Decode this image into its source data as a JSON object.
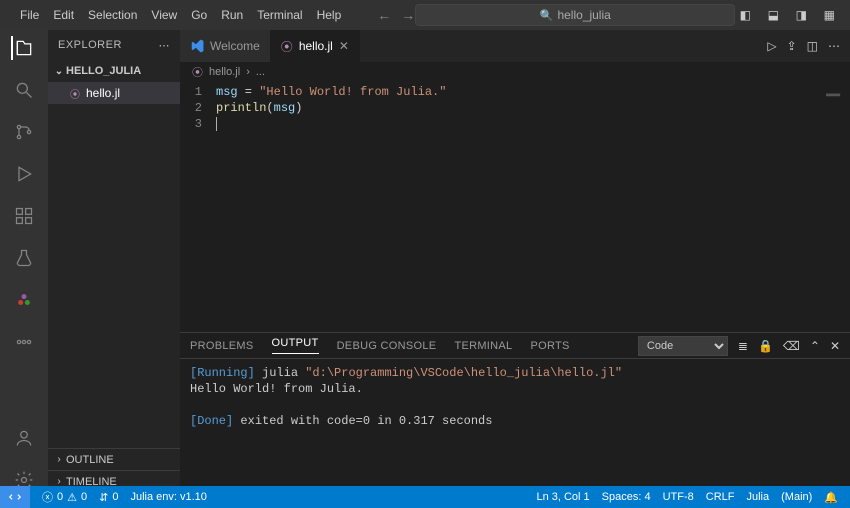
{
  "menu": {
    "items": [
      "File",
      "Edit",
      "Selection",
      "View",
      "Go",
      "Run",
      "Terminal",
      "Help"
    ]
  },
  "command_center": {
    "text": "hello_julia"
  },
  "explorer": {
    "title": "EXPLORER",
    "folder_name": "HELLO_JULIA",
    "file_name": "hello.jl",
    "outline_label": "OUTLINE",
    "timeline_label": "TIMELINE"
  },
  "tabs": {
    "welcome": "Welcome",
    "file": "hello.jl"
  },
  "breadcrumb": {
    "file": "hello.jl",
    "sep": "›",
    "tail": "..."
  },
  "editor": {
    "line_numbers": [
      "1",
      "2",
      "3"
    ],
    "l1_var": "msg",
    "l1_op": " = ",
    "l1_str": "\"Hello World! from Julia.\"",
    "l2_fn": "println",
    "l2_open": "(",
    "l2_arg": "msg",
    "l2_close": ")"
  },
  "panel": {
    "tabs": {
      "problems": "PROBLEMS",
      "output": "OUTPUT",
      "debug": "DEBUG CONSOLE",
      "terminal": "TERMINAL",
      "ports": "PORTS"
    },
    "channel": "Code",
    "out": {
      "running_tag": "[Running]",
      "running_cmd": " julia ",
      "running_path": "\"d:\\Programming\\VSCode\\hello_julia\\hello.jl\"",
      "stdout": "Hello World! from Julia.",
      "done_tag": "[Done]",
      "done_rest": " exited with code=0 in 0.317 seconds"
    }
  },
  "status": {
    "errors": "0",
    "warnings": "0",
    "ports": "0",
    "julia_env": "Julia env: v1.10",
    "ln_col": "Ln 3, Col 1",
    "spaces": "Spaces: 4",
    "encoding": "UTF-8",
    "eol": "CRLF",
    "lang": "Julia",
    "branch": "(Main)"
  }
}
